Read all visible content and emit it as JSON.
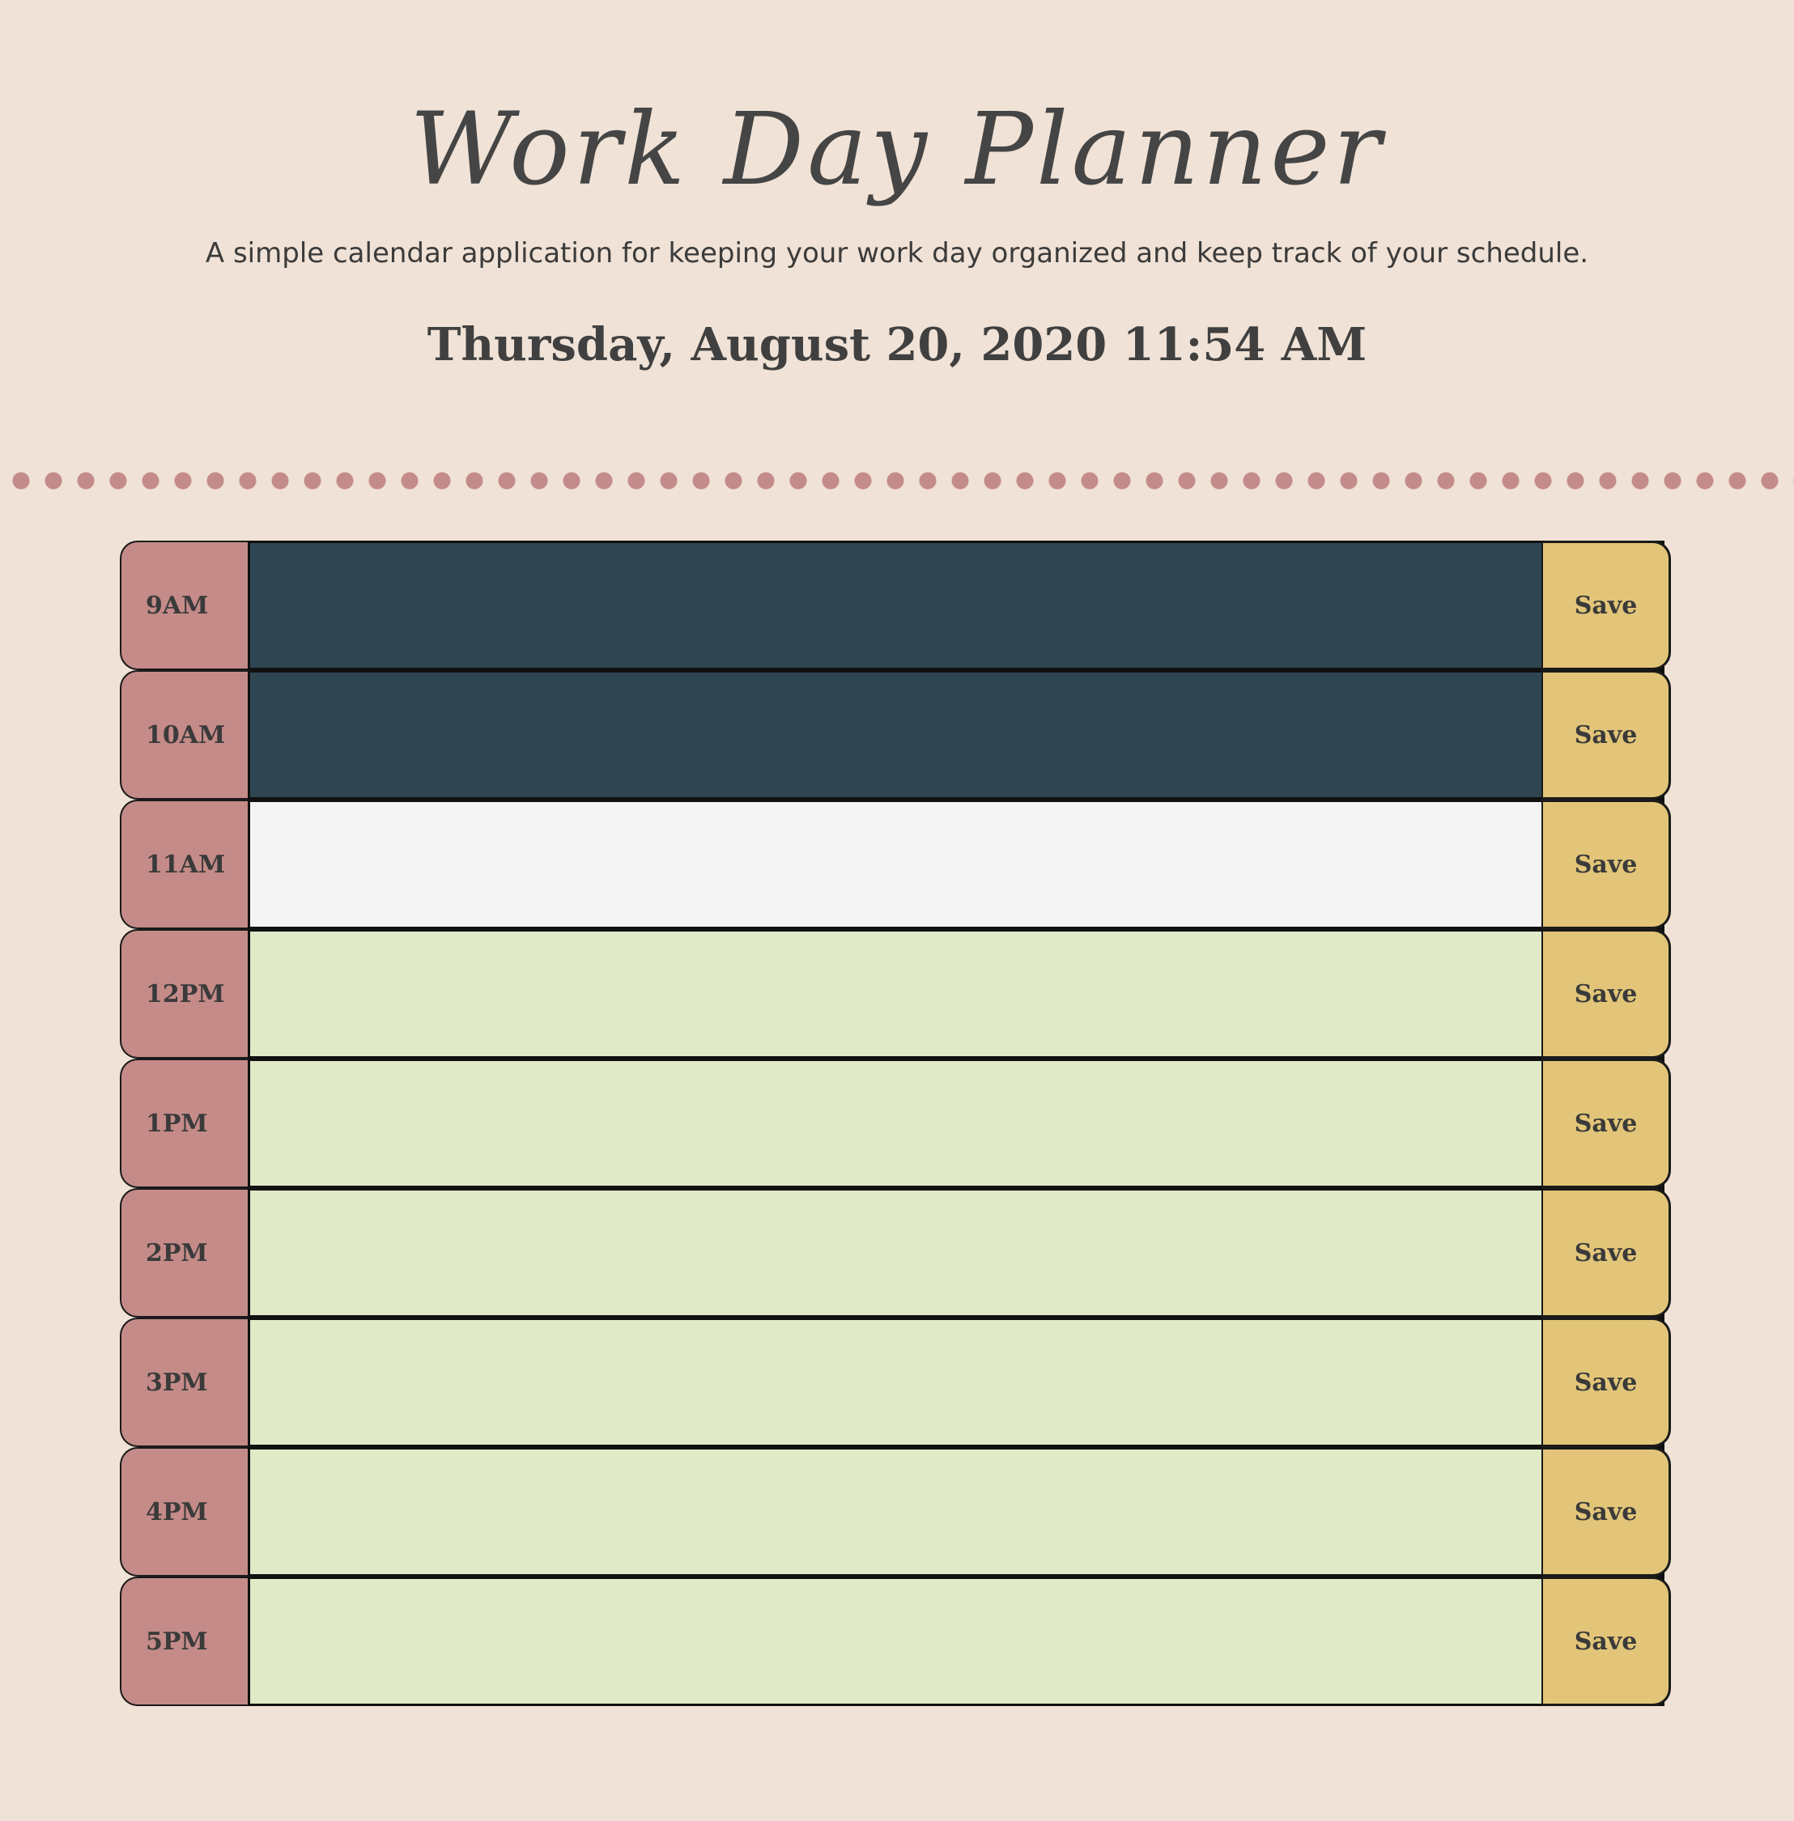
{
  "header": {
    "title": "Work Day Planner",
    "subtitle": "A simple calendar application for keeping your work day organized and keep track of your schedule.",
    "current_datetime": "Thursday, August 20, 2020 11:54 AM"
  },
  "colors": {
    "background": "#f0e2d6",
    "hour_cell": "#c48b88",
    "past": "#2f4552",
    "present": "#f4f4f4",
    "future": "#e0eac7",
    "save_button": "#e2c578",
    "divider_dots": "#c48b8b"
  },
  "planner": {
    "rows": [
      {
        "hour": "9AM",
        "status": "past",
        "text": "",
        "save_label": "Save"
      },
      {
        "hour": "10AM",
        "status": "past",
        "text": "",
        "save_label": "Save"
      },
      {
        "hour": "11AM",
        "status": "present",
        "text": "",
        "save_label": "Save"
      },
      {
        "hour": "12PM",
        "status": "future",
        "text": "",
        "save_label": "Save"
      },
      {
        "hour": "1PM",
        "status": "future",
        "text": "",
        "save_label": "Save"
      },
      {
        "hour": "2PM",
        "status": "future",
        "text": "",
        "save_label": "Save"
      },
      {
        "hour": "3PM",
        "status": "future",
        "text": "",
        "save_label": "Save"
      },
      {
        "hour": "4PM",
        "status": "future",
        "text": "",
        "save_label": "Save"
      },
      {
        "hour": "5PM",
        "status": "future",
        "text": "",
        "save_label": "Save"
      }
    ]
  }
}
